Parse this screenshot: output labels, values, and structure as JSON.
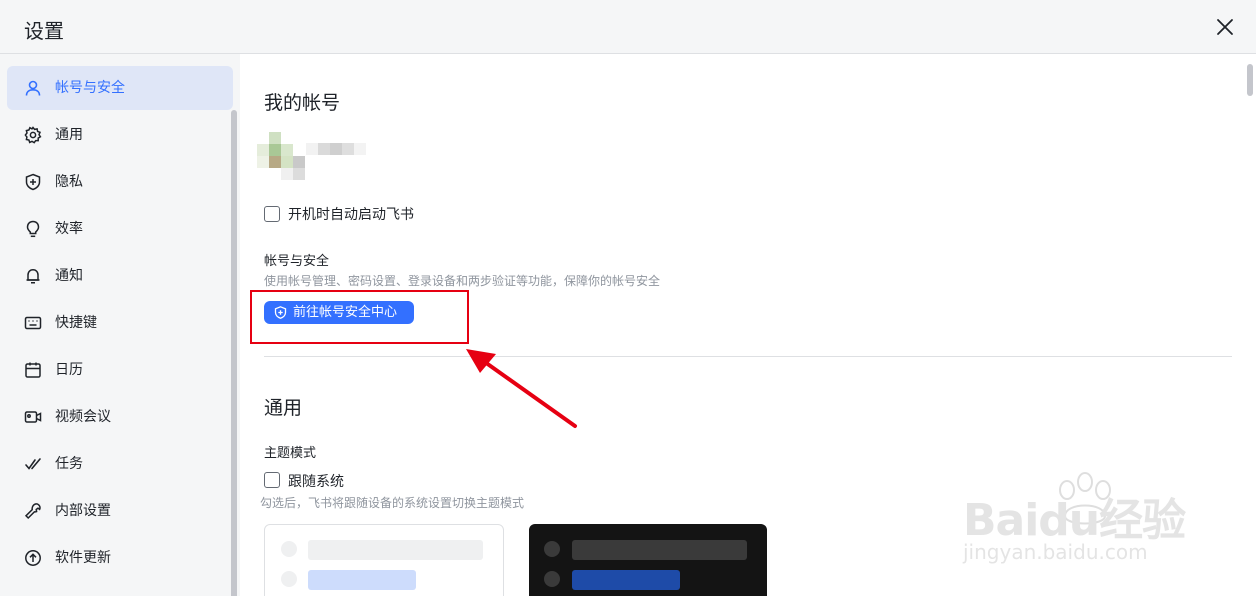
{
  "window": {
    "title": "设置",
    "close_icon": "close-icon"
  },
  "sidebar": {
    "items": [
      {
        "label": "帐号与安全",
        "icon": "user-icon",
        "active": true
      },
      {
        "label": "通用",
        "icon": "gear-icon",
        "active": false
      },
      {
        "label": "隐私",
        "icon": "shield-icon",
        "active": false
      },
      {
        "label": "效率",
        "icon": "lightbulb-icon",
        "active": false
      },
      {
        "label": "通知",
        "icon": "bell-icon",
        "active": false
      },
      {
        "label": "快捷键",
        "icon": "keyboard-icon",
        "active": false
      },
      {
        "label": "日历",
        "icon": "calendar-icon",
        "active": false
      },
      {
        "label": "视频会议",
        "icon": "video-icon",
        "active": false
      },
      {
        "label": "任务",
        "icon": "task-check-icon",
        "active": false
      },
      {
        "label": "内部设置",
        "icon": "wrench-icon",
        "active": false
      },
      {
        "label": "软件更新",
        "icon": "update-icon",
        "active": false
      }
    ]
  },
  "account": {
    "section_title": "我的帐号",
    "autostart_label": "开机时自动启动飞书",
    "autostart_checked": false,
    "security_label": "帐号与安全",
    "security_desc": "使用帐号管理、密码设置、登录设备和两步验证等功能，保障你的帐号安全",
    "security_button": "前往帐号安全中心"
  },
  "general": {
    "section_title": "通用",
    "theme_label": "主题模式",
    "follow_system_label": "跟随系统",
    "follow_system_checked": false,
    "follow_system_desc": "勾选后，飞书将跟随设备的系统设置切换主题模式"
  },
  "watermark": {
    "brand": "Baidu经验",
    "url": "jingyan.baidu.com"
  },
  "colors": {
    "accent": "#3370ff",
    "highlight_box": "#e60012",
    "sidebar_bg": "#f5f6f7",
    "active_bg": "#dfe6f7"
  }
}
